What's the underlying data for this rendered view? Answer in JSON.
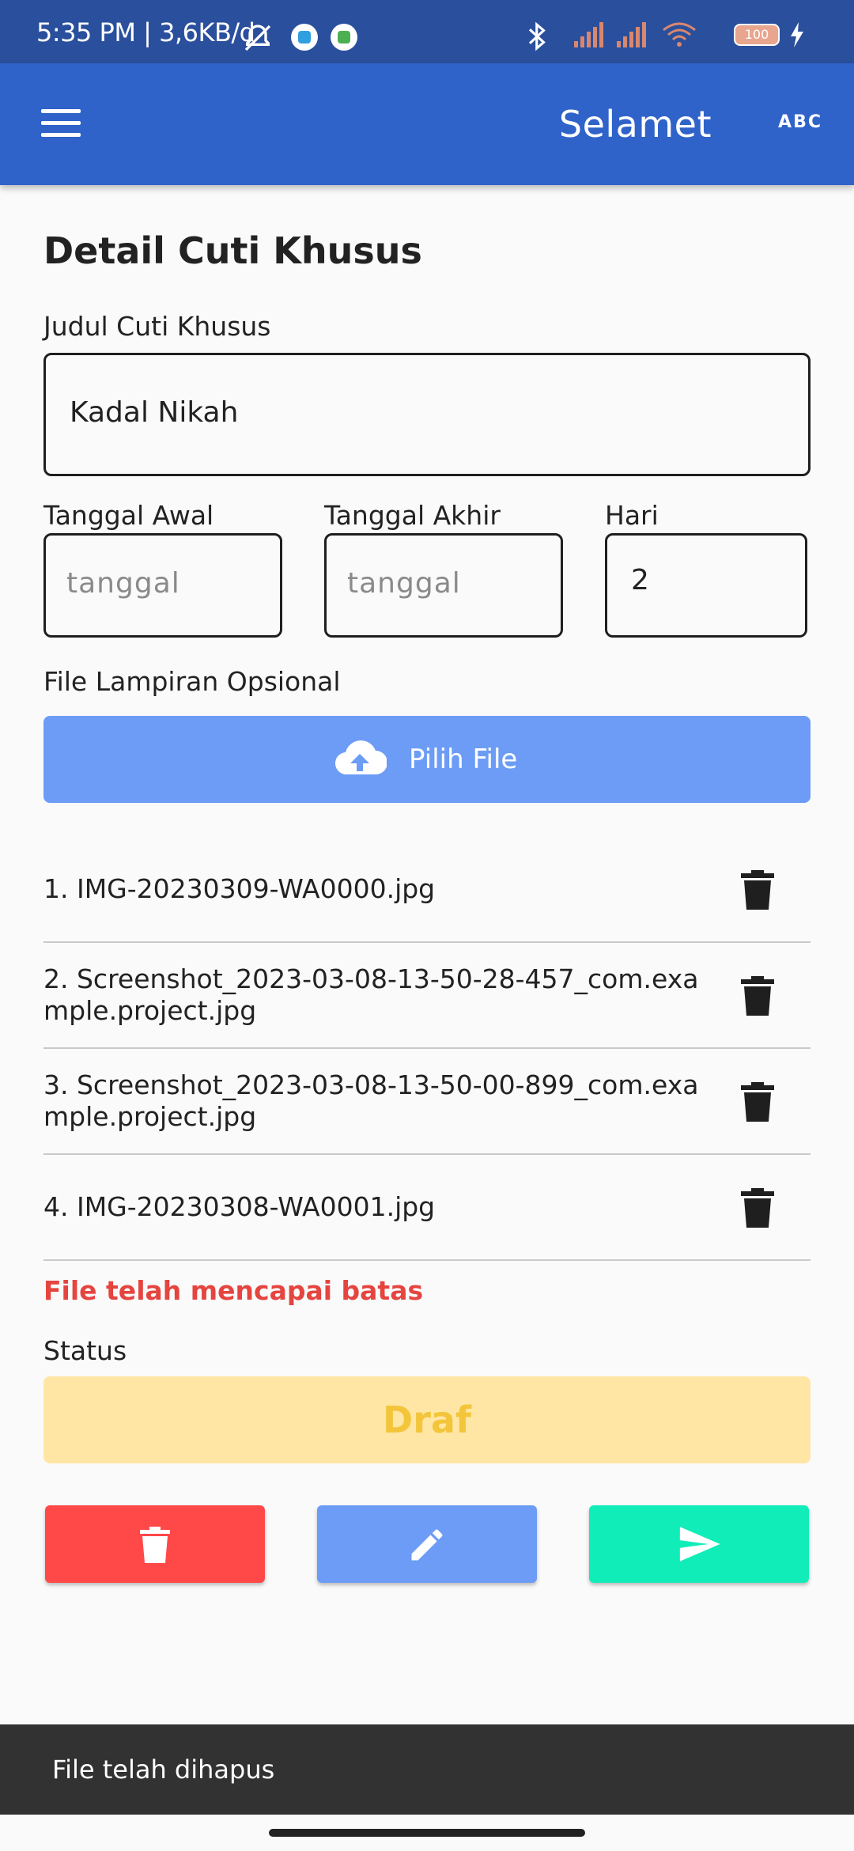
{
  "status_bar": {
    "time": "5:35 PM | 3,6KB/d",
    "battery": "100"
  },
  "app_bar": {
    "menu_icon": "hamburger-icon",
    "title": "Selamet",
    "abc_label": "ABC"
  },
  "form": {
    "heading": "Detail Cuti Khusus",
    "judul_label": "Judul Cuti Khusus",
    "judul_value": "Kadal Nikah",
    "tanggal_awal_label": "Tanggal Awal",
    "tanggal_awal_placeholder": "tanggal",
    "tanggal_akhir_label": "Tanggal Akhir",
    "tanggal_akhir_placeholder": "tanggal",
    "hari_label": "Hari",
    "hari_value": "2",
    "lampiran_label": "File Lampiran Opsional",
    "pick_file_label": "Pilih File"
  },
  "files": [
    "1. IMG-20230309-WA0000.jpg",
    "2. Screenshot_2023-03-08-13-50-28-457_com.example.project.jpg",
    "3. Screenshot_2023-03-08-13-50-00-899_com.example.project.jpg",
    "4. IMG-20230308-WA0001.jpg"
  ],
  "limit_message": "File telah mencapai batas",
  "status": {
    "label": "Status",
    "value": "Draf"
  },
  "actions": {
    "delete_icon": "trash-icon",
    "edit_icon": "pencil-icon",
    "send_icon": "send-icon"
  },
  "snackbar": {
    "message": "File telah dihapus"
  },
  "colors": {
    "app_bar": "#2f63c9",
    "status_bar": "#2a4f9c",
    "primary_button": "#6c9cf5",
    "delete_button": "#ff4848",
    "send_button": "#11edb8",
    "error_text": "#e5443f",
    "draft_bg": "#ffe6a4",
    "draft_text": "#f3c53a"
  }
}
